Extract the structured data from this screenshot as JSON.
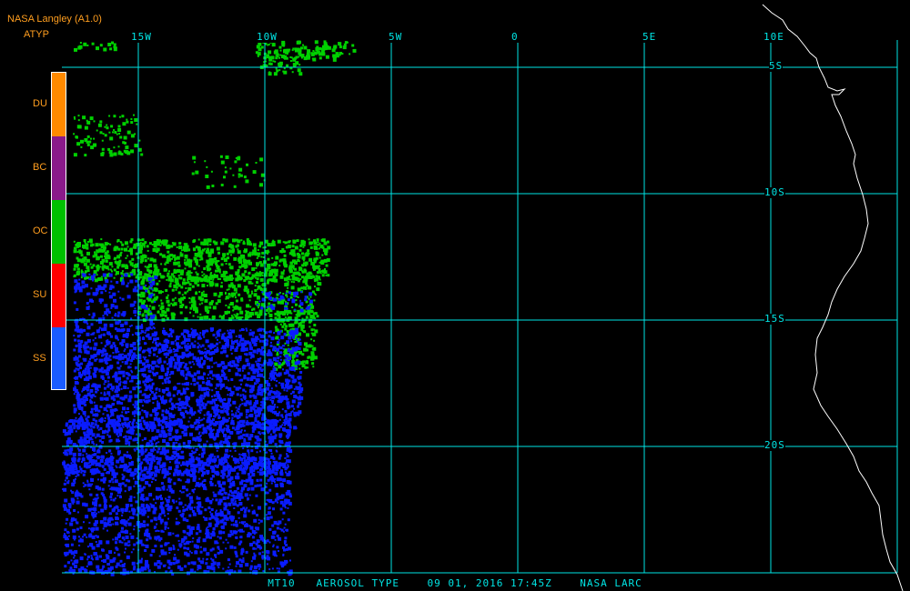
{
  "header": {
    "source": "NASA Langley (A1.0)",
    "product": "ATYP"
  },
  "legend": [
    {
      "label": "DU",
      "color": "#ff8a00"
    },
    {
      "label": "BC",
      "color": "#8a1a8a"
    },
    {
      "label": "OC",
      "color": "#00c000"
    },
    {
      "label": "SU",
      "color": "#ff0000"
    },
    {
      "label": "SS",
      "color": "#1a5cff"
    }
  ],
  "grid": {
    "longitude_labels": [
      "15W",
      "10W",
      "5W",
      "0",
      "5E",
      "10E"
    ],
    "latitude_labels": [
      "5S",
      "10S",
      "15S",
      "20S"
    ],
    "color": "#00e5e5"
  },
  "footer": {
    "caption": "MT10   AEROSOL TYPE    09 01, 2016 17:45Z    NASA LARC"
  },
  "colors": {
    "background": "#000000",
    "coastline": "#ffffff",
    "aerosol_green": "#00d000",
    "aerosol_blue": "#0a1cff"
  }
}
